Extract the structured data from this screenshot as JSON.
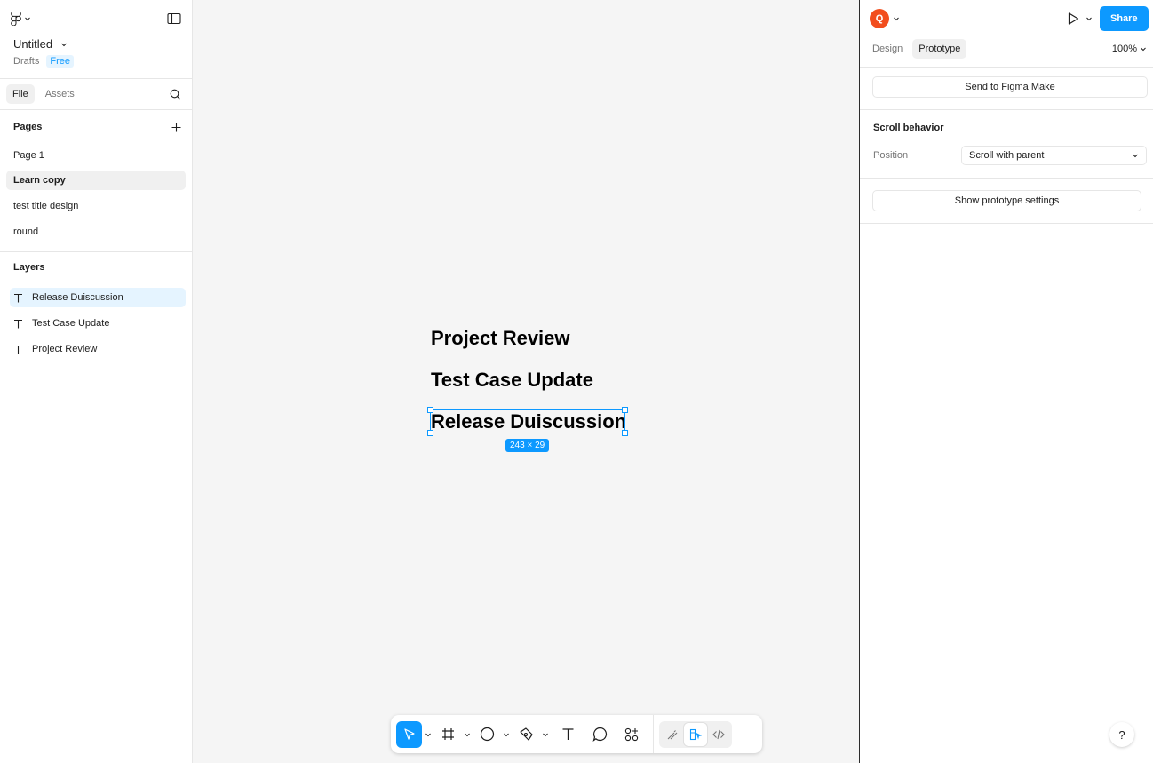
{
  "file": {
    "title": "Untitled",
    "location": "Drafts",
    "plan_badge": "Free"
  },
  "left_tabs": [
    "File",
    "Assets"
  ],
  "pages": {
    "heading": "Pages",
    "items": [
      "Page 1",
      "Learn copy",
      "test  title design",
      "round"
    ],
    "selected": "Learn copy"
  },
  "layers": {
    "heading": "Layers",
    "items": [
      "Release Duiscussion",
      "Test Case Update",
      "Project Review"
    ],
    "selected": "Release Duiscussion"
  },
  "canvas": {
    "texts": [
      "Project Review",
      "Test Case Update",
      "Release Duiscussion"
    ],
    "selection_dimensions": "243 × 29"
  },
  "right_panel": {
    "avatar_initial": "Q",
    "share_label": "Share",
    "tabs": [
      "Design",
      "Prototype"
    ],
    "active_tab": "Prototype",
    "zoom": "100%",
    "send_button": "Send to Figma Make",
    "scroll_section_title": "Scroll behavior",
    "position_label": "Position",
    "position_value": "Scroll with parent",
    "prototype_settings_button": "Show prototype settings",
    "help_label": "?"
  },
  "colors": {
    "accent": "#0d99ff",
    "avatar": "#f24e1e"
  }
}
